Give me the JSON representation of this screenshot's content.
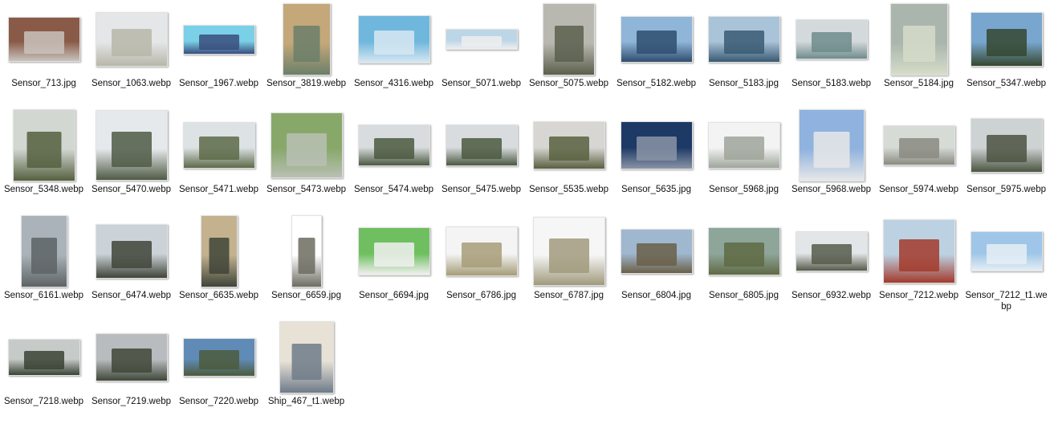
{
  "files": [
    {
      "name": "Sensor_713.jpg",
      "thumb": {
        "w": 90,
        "h": 56,
        "bg": "#8a5a48",
        "fg": "#c9c3bd",
        "icon": "photo-icon"
      }
    },
    {
      "name": "Sensor_1063.webp",
      "thumb": {
        "w": 90,
        "h": 68,
        "bg": "#e4e6e8",
        "fg": "#b7b7a8",
        "icon": "photo-icon"
      }
    },
    {
      "name": "Sensor_1967.webp",
      "thumb": {
        "w": 90,
        "h": 37,
        "bg": "#7ad0e6",
        "fg": "#3a4e7c",
        "icon": "photo-icon"
      }
    },
    {
      "name": "Sensor_3819.webp",
      "thumb": {
        "w": 60,
        "h": 90,
        "bg": "#c4a87a",
        "fg": "#6b7f6a",
        "icon": "photo-icon"
      }
    },
    {
      "name": "Sensor_4316.webp",
      "thumb": {
        "w": 90,
        "h": 60,
        "bg": "#6fb7dd",
        "fg": "#d8e8f2",
        "icon": "photo-icon"
      }
    },
    {
      "name": "Sensor_5071.webp",
      "thumb": {
        "w": 90,
        "h": 26,
        "bg": "#bcd6e8",
        "fg": "#eeeeee",
        "icon": "photo-icon"
      }
    },
    {
      "name": "Sensor_5075.webp",
      "thumb": {
        "w": 65,
        "h": 90,
        "bg": "#b9b8b0",
        "fg": "#5b5f4d",
        "icon": "photo-icon"
      }
    },
    {
      "name": "Sensor_5182.webp",
      "thumb": {
        "w": 90,
        "h": 58,
        "bg": "#8fb5d8",
        "fg": "#2f4e70",
        "icon": "photo-icon"
      }
    },
    {
      "name": "Sensor_5183.jpg",
      "thumb": {
        "w": 90,
        "h": 58,
        "bg": "#a9c3d9",
        "fg": "#385a72",
        "icon": "photo-icon"
      }
    },
    {
      "name": "Sensor_5183.webp",
      "thumb": {
        "w": 90,
        "h": 50,
        "bg": "#d4dadc",
        "fg": "#6f8b8b",
        "icon": "photo-icon"
      }
    },
    {
      "name": "Sensor_5184.jpg",
      "thumb": {
        "w": 72,
        "h": 90,
        "bg": "#aab6ad",
        "fg": "#d6dcc9",
        "icon": "photo-icon"
      }
    },
    {
      "name": "Sensor_5347.webp",
      "thumb": {
        "w": 90,
        "h": 68,
        "bg": "#78a6cf",
        "fg": "#35472f",
        "icon": "photo-icon"
      }
    },
    {
      "name": "Sensor_5348.webp",
      "thumb": {
        "w": 78,
        "h": 90,
        "bg": "#d2d7d2",
        "fg": "#55603f",
        "icon": "photo-icon"
      }
    },
    {
      "name": "Sensor_5470.webp",
      "thumb": {
        "w": 90,
        "h": 88,
        "bg": "#e6e9ec",
        "fg": "#4f5a45",
        "icon": "photo-icon"
      }
    },
    {
      "name": "Sensor_5471.webp",
      "thumb": {
        "w": 90,
        "h": 58,
        "bg": "#dde2e4",
        "fg": "#5d6a48",
        "icon": "photo-icon"
      }
    },
    {
      "name": "Sensor_5473.webp",
      "thumb": {
        "w": 90,
        "h": 82,
        "bg": "#88a86a",
        "fg": "#b8c0b4",
        "icon": "photo-icon"
      }
    },
    {
      "name": "Sensor_5474.webp",
      "thumb": {
        "w": 90,
        "h": 52,
        "bg": "#d8dcde",
        "fg": "#4b5940",
        "icon": "photo-icon"
      }
    },
    {
      "name": "Sensor_5475.webp",
      "thumb": {
        "w": 90,
        "h": 52,
        "bg": "#d8dcde",
        "fg": "#4b5940",
        "icon": "photo-icon"
      }
    },
    {
      "name": "Sensor_5535.webp",
      "thumb": {
        "w": 90,
        "h": 60,
        "bg": "#d7d6d2",
        "fg": "#59603f",
        "icon": "photo-icon"
      }
    },
    {
      "name": "Sensor_5635.jpg",
      "thumb": {
        "w": 90,
        "h": 60,
        "bg": "#1d3a66",
        "fg": "#8a94a6",
        "icon": "photo-icon"
      }
    },
    {
      "name": "Sensor_5968.jpg",
      "thumb": {
        "w": 90,
        "h": 58,
        "bg": "#f3f3f3",
        "fg": "#9ea59a",
        "icon": "photo-icon"
      }
    },
    {
      "name": "Sensor_5968.webp",
      "thumb": {
        "w": 82,
        "h": 90,
        "bg": "#8fb2de",
        "fg": "#e8e8e8",
        "icon": "photo-icon"
      }
    },
    {
      "name": "Sensor_5974.webp",
      "thumb": {
        "w": 90,
        "h": 50,
        "bg": "#d6dbd6",
        "fg": "#8a8a80",
        "icon": "photo-icon"
      }
    },
    {
      "name": "Sensor_5975.webp",
      "thumb": {
        "w": 90,
        "h": 68,
        "bg": "#cdd2d2",
        "fg": "#4c5442",
        "icon": "photo-icon"
      }
    },
    {
      "name": "Sensor_6161.webp",
      "thumb": {
        "w": 58,
        "h": 90,
        "bg": "#aab3b9",
        "fg": "#5d6365",
        "icon": "photo-icon"
      }
    },
    {
      "name": "Sensor_6474.webp",
      "thumb": {
        "w": 90,
        "h": 68,
        "bg": "#cbd2d8",
        "fg": "#3f4538",
        "icon": "photo-icon"
      }
    },
    {
      "name": "Sensor_6635.webp",
      "thumb": {
        "w": 46,
        "h": 90,
        "bg": "#c4b28f",
        "fg": "#3f4438",
        "icon": "photo-icon"
      }
    },
    {
      "name": "Sensor_6659.jpg",
      "thumb": {
        "w": 38,
        "h": 90,
        "bg": "#ffffff",
        "fg": "#6c6c62",
        "icon": "photo-icon"
      }
    },
    {
      "name": "Sensor_6694.jpg",
      "thumb": {
        "w": 90,
        "h": 60,
        "bg": "#6fbf60",
        "fg": "#f1f1f1",
        "icon": "photo-icon"
      }
    },
    {
      "name": "Sensor_6786.jpg",
      "thumb": {
        "w": 90,
        "h": 62,
        "bg": "#f4f4f4",
        "fg": "#a69c78",
        "icon": "photo-icon"
      }
    },
    {
      "name": "Sensor_6787.jpg",
      "thumb": {
        "w": 90,
        "h": 86,
        "bg": "#f6f6f6",
        "fg": "#a09a7c",
        "icon": "photo-icon"
      }
    },
    {
      "name": "Sensor_6804.jpg",
      "thumb": {
        "w": 90,
        "h": 56,
        "bg": "#9fb7cf",
        "fg": "#6a5f48",
        "icon": "photo-icon"
      }
    },
    {
      "name": "Sensor_6805.jpg",
      "thumb": {
        "w": 90,
        "h": 60,
        "bg": "#8ea59a",
        "fg": "#5f6a43",
        "icon": "photo-icon"
      }
    },
    {
      "name": "Sensor_6932.webp",
      "thumb": {
        "w": 90,
        "h": 50,
        "bg": "#e2e6e8",
        "fg": "#555b4a",
        "icon": "photo-icon"
      }
    },
    {
      "name": "Sensor_7212.webp",
      "thumb": {
        "w": 90,
        "h": 80,
        "bg": "#bcd2e3",
        "fg": "#a33a2c",
        "icon": "photo-icon"
      }
    },
    {
      "name": "Sensor_7212_t1.webp",
      "thumb": {
        "w": 90,
        "h": 50,
        "bg": "#9fc6e8",
        "fg": "#e6eef4",
        "icon": "photo-icon"
      }
    },
    {
      "name": "Sensor_7218.webp",
      "thumb": {
        "w": 90,
        "h": 46,
        "bg": "#c6cbc9",
        "fg": "#3a4234",
        "icon": "photo-icon"
      }
    },
    {
      "name": "Sensor_7219.webp",
      "thumb": {
        "w": 90,
        "h": 60,
        "bg": "#b8bcbe",
        "fg": "#3f4638",
        "icon": "photo-icon"
      }
    },
    {
      "name": "Sensor_7220.webp",
      "thumb": {
        "w": 90,
        "h": 48,
        "bg": "#5f8bb6",
        "fg": "#4c5a3c",
        "icon": "photo-icon"
      }
    },
    {
      "name": "Ship_467_t1.webp",
      "thumb": {
        "w": 68,
        "h": 90,
        "bg": "#e8e2d6",
        "fg": "#6e7b8a",
        "icon": "document-icon"
      }
    }
  ]
}
